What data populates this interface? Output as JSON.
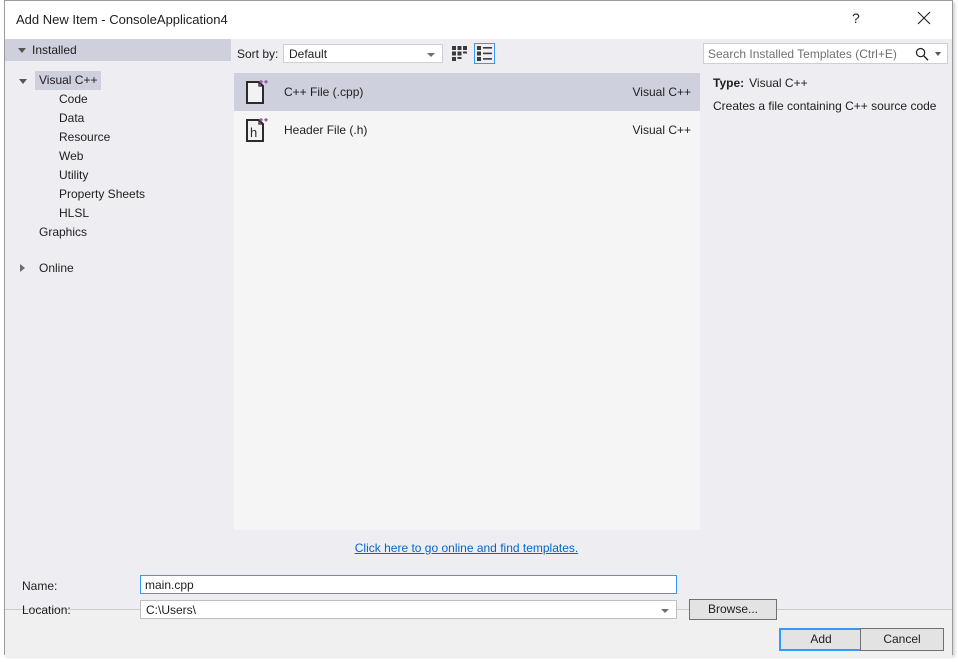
{
  "dialog": {
    "title": "Add New Item - ConsoleApplication4",
    "help_button": "?",
    "close_button": "×"
  },
  "sidebar": {
    "header": "Installed",
    "tree": [
      {
        "label": "Visual C++",
        "level": 1,
        "expanded": true,
        "selected": true
      },
      {
        "label": "Code",
        "level": 2,
        "expanded": false,
        "selected": false
      },
      {
        "label": "Data",
        "level": 2,
        "expanded": false,
        "selected": false
      },
      {
        "label": "Resource",
        "level": 2,
        "expanded": false,
        "selected": false
      },
      {
        "label": "Web",
        "level": 2,
        "expanded": false,
        "selected": false
      },
      {
        "label": "Utility",
        "level": 2,
        "expanded": false,
        "selected": false
      },
      {
        "label": "Property Sheets",
        "level": 2,
        "expanded": false,
        "selected": false
      },
      {
        "label": "HLSL",
        "level": 2,
        "expanded": false,
        "selected": false
      },
      {
        "label": "Graphics",
        "level": 1,
        "expanded": false,
        "selected": false
      }
    ],
    "online_node": "Online"
  },
  "toolbar": {
    "sort_by_label": "Sort by:",
    "sort_by_value": "Default",
    "sort_by_options": [
      "Default"
    ],
    "view_tiles_icon": "grid-view-icon",
    "view_list_icon": "list-view-icon",
    "view_mode_selected": "list"
  },
  "templates": {
    "items": [
      {
        "name": "C++ File (.cpp)",
        "category": "Visual C++",
        "icon": "cpp-file-icon",
        "selected": true
      },
      {
        "name": "Header File (.h)",
        "category": "Visual C++",
        "icon": "header-file-icon",
        "selected": false
      }
    ],
    "online_link": "Click here to go online and find templates."
  },
  "search": {
    "placeholder": "Search Installed Templates (Ctrl+E)",
    "value": "",
    "icon": "search-icon"
  },
  "details": {
    "type_label": "Type:",
    "type_value": "Visual C++",
    "description": "Creates a file containing C++ source code"
  },
  "footer": {
    "name_label": "Name:",
    "name_value": "main.cpp",
    "location_label": "Location:",
    "location_value": "C:\\Users\\",
    "browse_label": "Browse...",
    "add_label": "Add",
    "cancel_label": "Cancel"
  },
  "colors": {
    "accent_focus": "#3399ff",
    "selection": "#cfd0dd",
    "panel_bg": "#eeeef2",
    "list_bg": "#f5f5f5",
    "link": "#0066cc",
    "icon_accent": "#9b4f96"
  }
}
